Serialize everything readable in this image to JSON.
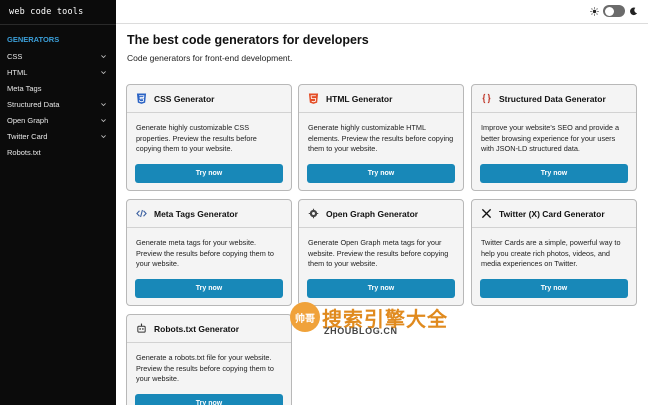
{
  "sidebar": {
    "brand": "web code tools",
    "heading": "GENERATORS",
    "items": [
      {
        "label": "CSS",
        "has_children": true
      },
      {
        "label": "HTML",
        "has_children": true
      },
      {
        "label": "Meta Tags",
        "has_children": false
      },
      {
        "label": "Structured Data",
        "has_children": true
      },
      {
        "label": "Open Graph",
        "has_children": true
      },
      {
        "label": "Twitter Card",
        "has_children": true
      },
      {
        "label": "Robots.txt",
        "has_children": false
      }
    ]
  },
  "topbar": {
    "light_icon": "sun-icon",
    "dark_icon": "moon-icon",
    "theme": "light"
  },
  "main": {
    "title": "The best code generators for developers",
    "subtitle": "Code generators for front-end development.",
    "cards": [
      {
        "title": "CSS Generator",
        "icon": "css3-icon",
        "description": "Generate highly customizable CSS properties. Preview the results before copying them to your website.",
        "button": "Try now"
      },
      {
        "title": "HTML Generator",
        "icon": "html5-icon",
        "description": "Generate highly customizable HTML elements. Preview the results before copying them to your website.",
        "button": "Try now"
      },
      {
        "title": "Structured Data Generator",
        "icon": "braces-icon",
        "description": "Improve your website's SEO and provide a better browsing experience for your users with JSON-LD structured data.",
        "button": "Try now"
      },
      {
        "title": "Meta Tags Generator",
        "icon": "code-brackets-icon",
        "description": "Generate meta tags for your website. Preview the results before copying them to your website.",
        "button": "Try now"
      },
      {
        "title": "Open Graph Generator",
        "icon": "open-graph-icon",
        "description": "Generate Open Graph meta tags for your website. Preview the results before copying them to your website.",
        "button": "Try now"
      },
      {
        "title": "Twitter (X) Card Generator",
        "icon": "x-logo-icon",
        "description": "Twitter Cards are a simple, powerful way to help you create rich photos, videos, and media experiences on Twitter.",
        "button": "Try now"
      },
      {
        "title": "Robots.txt Generator",
        "icon": "robot-icon",
        "description": "Generate a robots.txt file for your website. Preview the results before copying them to your website.",
        "button": "Try now"
      }
    ]
  },
  "watermark": {
    "logo_text": "帅哥",
    "text": "搜索引擎大全",
    "sub": "ZHOUBLOG.CN"
  },
  "colors": {
    "sidebar_bg": "#0b0b0b",
    "accent": "#3b9fd9",
    "button": "#1888b8",
    "css_icon": "#2b63c4",
    "html_icon": "#e44d26",
    "braces_icon": "#c0392b"
  }
}
